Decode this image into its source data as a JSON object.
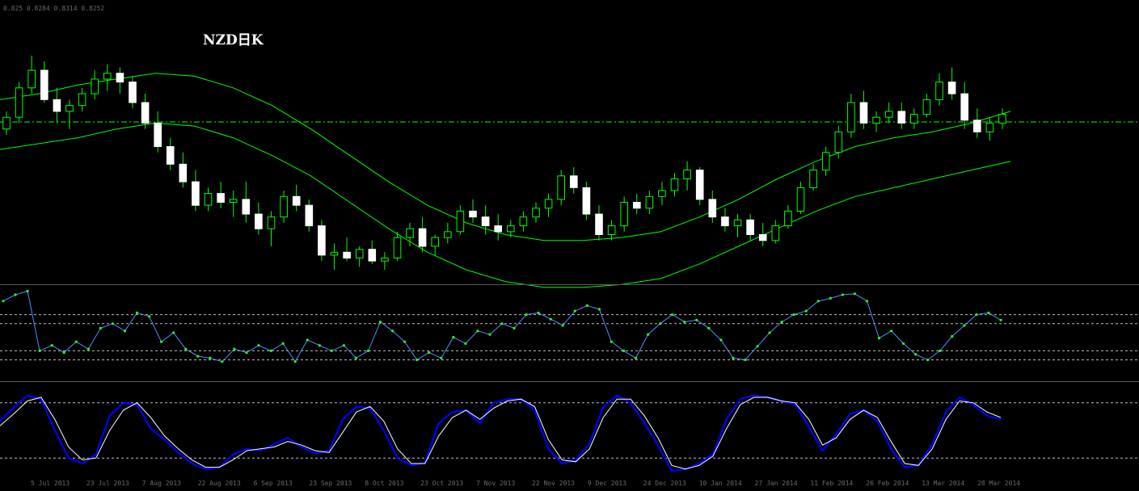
{
  "header": {
    "title": "NZD日K",
    "info": "0.825 0.8284 0.8314 0.8252"
  },
  "colors": {
    "background": "#000000",
    "bull_body": "#000000",
    "bull_outline": "#00ff00",
    "bear_body": "#ffffff",
    "wick": "#00ff00",
    "envelope": "#00ff00",
    "price_line": "#00ff00",
    "rsi_line": "#4f8fff",
    "rsi_marker": "#22ff22",
    "stoch_main": "#0000ff",
    "stoch_signal": "#ffffff",
    "level_line": "#c0c0c0",
    "separator": "#5a5a5a",
    "axis_text": "#6a6a6a"
  },
  "time_axis": {
    "labels": [
      "5 Jul 2013",
      "23 Jul 2013",
      "7 Aug 2013",
      "22 Aug 2013",
      "6 Sep 2013",
      "23 Sep 2013",
      "8 Oct 2013",
      "23 Oct 2013",
      "7 Nov 2013",
      "22 Nov 2013",
      "9 Dec 2013",
      "24 Dec 2013",
      "10 Jan 2014",
      "27 Jan 2014",
      "11 Feb 2014",
      "26 Feb 2014",
      "13 Mar 2014",
      "28 Mar 2014"
    ]
  },
  "chart_data": [
    {
      "type": "candlestick",
      "name": "price",
      "ylim": [
        0.775,
        0.865
      ],
      "current_price": 0.8284,
      "envelope_upper": [
        0.836,
        0.838,
        0.841,
        0.843,
        0.845,
        0.844,
        0.84,
        0.834,
        0.826,
        0.817,
        0.808,
        0.8,
        0.794,
        0.79,
        0.788,
        0.788,
        0.789,
        0.791,
        0.796,
        0.802,
        0.809,
        0.815,
        0.82,
        0.823,
        0.825,
        0.828,
        0.832
      ],
      "envelope_lower": [
        0.819,
        0.821,
        0.823,
        0.826,
        0.828,
        0.827,
        0.823,
        0.817,
        0.81,
        0.801,
        0.792,
        0.784,
        0.778,
        0.774,
        0.772,
        0.772,
        0.773,
        0.775,
        0.78,
        0.786,
        0.792,
        0.798,
        0.803,
        0.806,
        0.809,
        0.812,
        0.815
      ],
      "candles": [
        [
          0.826,
          0.832,
          0.824,
          0.83
        ],
        [
          0.83,
          0.842,
          0.828,
          0.84
        ],
        [
          0.84,
          0.851,
          0.838,
          0.846
        ],
        [
          0.846,
          0.849,
          0.835,
          0.836
        ],
        [
          0.836,
          0.84,
          0.828,
          0.832
        ],
        [
          0.832,
          0.836,
          0.826,
          0.834
        ],
        [
          0.834,
          0.84,
          0.832,
          0.838
        ],
        [
          0.838,
          0.846,
          0.836,
          0.843
        ],
        [
          0.843,
          0.848,
          0.839,
          0.845
        ],
        [
          0.845,
          0.847,
          0.838,
          0.842
        ],
        [
          0.842,
          0.844,
          0.833,
          0.835
        ],
        [
          0.835,
          0.838,
          0.826,
          0.828
        ],
        [
          0.828,
          0.832,
          0.818,
          0.82
        ],
        [
          0.82,
          0.823,
          0.812,
          0.814
        ],
        [
          0.814,
          0.818,
          0.806,
          0.808
        ],
        [
          0.808,
          0.812,
          0.798,
          0.8
        ],
        [
          0.8,
          0.806,
          0.798,
          0.804
        ],
        [
          0.804,
          0.808,
          0.799,
          0.801
        ],
        [
          0.801,
          0.805,
          0.796,
          0.802
        ],
        [
          0.802,
          0.808,
          0.794,
          0.797
        ],
        [
          0.797,
          0.801,
          0.79,
          0.792
        ],
        [
          0.792,
          0.798,
          0.786,
          0.796
        ],
        [
          0.796,
          0.805,
          0.794,
          0.803
        ],
        [
          0.803,
          0.807,
          0.798,
          0.8
        ],
        [
          0.8,
          0.802,
          0.791,
          0.793
        ],
        [
          0.793,
          0.795,
          0.781,
          0.783
        ],
        [
          0.783,
          0.787,
          0.778,
          0.784
        ],
        [
          0.784,
          0.789,
          0.781,
          0.782
        ],
        [
          0.782,
          0.786,
          0.779,
          0.785
        ],
        [
          0.785,
          0.788,
          0.78,
          0.781
        ],
        [
          0.781,
          0.784,
          0.778,
          0.782
        ],
        [
          0.782,
          0.791,
          0.781,
          0.789
        ],
        [
          0.789,
          0.794,
          0.786,
          0.792
        ],
        [
          0.792,
          0.796,
          0.784,
          0.786
        ],
        [
          0.786,
          0.79,
          0.783,
          0.789
        ],
        [
          0.789,
          0.794,
          0.787,
          0.791
        ],
        [
          0.791,
          0.8,
          0.79,
          0.798
        ],
        [
          0.798,
          0.802,
          0.794,
          0.796
        ],
        [
          0.796,
          0.8,
          0.79,
          0.793
        ],
        [
          0.793,
          0.797,
          0.788,
          0.791
        ],
        [
          0.791,
          0.795,
          0.789,
          0.793
        ],
        [
          0.793,
          0.798,
          0.791,
          0.796
        ],
        [
          0.796,
          0.801,
          0.794,
          0.799
        ],
        [
          0.799,
          0.804,
          0.796,
          0.802
        ],
        [
          0.802,
          0.812,
          0.8,
          0.81
        ],
        [
          0.81,
          0.813,
          0.804,
          0.806
        ],
        [
          0.806,
          0.808,
          0.795,
          0.797
        ],
        [
          0.797,
          0.8,
          0.788,
          0.79
        ],
        [
          0.79,
          0.795,
          0.788,
          0.793
        ],
        [
          0.793,
          0.803,
          0.791,
          0.801
        ],
        [
          0.801,
          0.804,
          0.797,
          0.799
        ],
        [
          0.799,
          0.805,
          0.797,
          0.803
        ],
        [
          0.803,
          0.808,
          0.8,
          0.805
        ],
        [
          0.805,
          0.811,
          0.803,
          0.809
        ],
        [
          0.809,
          0.815,
          0.805,
          0.812
        ],
        [
          0.812,
          0.813,
          0.8,
          0.802
        ],
        [
          0.802,
          0.805,
          0.794,
          0.796
        ],
        [
          0.796,
          0.799,
          0.791,
          0.793
        ],
        [
          0.793,
          0.797,
          0.789,
          0.795
        ],
        [
          0.795,
          0.797,
          0.788,
          0.79
        ],
        [
          0.79,
          0.794,
          0.786,
          0.788
        ],
        [
          0.788,
          0.795,
          0.787,
          0.793
        ],
        [
          0.793,
          0.8,
          0.792,
          0.798
        ],
        [
          0.798,
          0.808,
          0.797,
          0.806
        ],
        [
          0.806,
          0.814,
          0.805,
          0.812
        ],
        [
          0.812,
          0.82,
          0.81,
          0.818
        ],
        [
          0.818,
          0.827,
          0.816,
          0.825
        ],
        [
          0.825,
          0.838,
          0.823,
          0.835
        ],
        [
          0.835,
          0.839,
          0.826,
          0.828
        ],
        [
          0.828,
          0.832,
          0.825,
          0.83
        ],
        [
          0.83,
          0.835,
          0.828,
          0.832
        ],
        [
          0.832,
          0.835,
          0.826,
          0.828
        ],
        [
          0.828,
          0.833,
          0.826,
          0.831
        ],
        [
          0.831,
          0.838,
          0.83,
          0.836
        ],
        [
          0.836,
          0.845,
          0.834,
          0.842
        ],
        [
          0.842,
          0.847,
          0.836,
          0.838
        ],
        [
          0.838,
          0.842,
          0.826,
          0.829
        ],
        [
          0.829,
          0.833,
          0.823,
          0.825
        ],
        [
          0.825,
          0.83,
          0.822,
          0.828
        ],
        [
          0.828,
          0.833,
          0.826,
          0.831
        ]
      ]
    },
    {
      "type": "line",
      "name": "oscillator-1",
      "ylim": [
        0,
        100
      ],
      "levels": [
        70,
        60,
        30,
        20
      ],
      "values": [
        85,
        92,
        96,
        30,
        36,
        28,
        40,
        32,
        55,
        60,
        52,
        72,
        68,
        40,
        50,
        32,
        24,
        22,
        18,
        32,
        28,
        36,
        30,
        38,
        18,
        42,
        36,
        30,
        36,
        22,
        30,
        62,
        52,
        40,
        20,
        28,
        22,
        45,
        38,
        52,
        48,
        60,
        55,
        70,
        72,
        65,
        58,
        74,
        80,
        76,
        40,
        30,
        22,
        48,
        60,
        70,
        62,
        64,
        55,
        42,
        22,
        20,
        35,
        50,
        62,
        70,
        74,
        85,
        88,
        92,
        93,
        85,
        44,
        52,
        38,
        26,
        20,
        30,
        46,
        58,
        70,
        72,
        64
      ]
    },
    {
      "type": "line",
      "name": "oscillator-2",
      "ylim": [
        0,
        100
      ],
      "levels": [
        80,
        20
      ],
      "main": [
        60,
        75,
        88,
        84,
        50,
        20,
        14,
        24,
        66,
        80,
        78,
        52,
        40,
        26,
        14,
        8,
        10,
        24,
        30,
        28,
        35,
        42,
        32,
        25,
        28,
        62,
        76,
        74,
        50,
        20,
        12,
        15,
        58,
        70,
        72,
        58,
        80,
        84,
        84,
        72,
        30,
        14,
        18,
        36,
        75,
        88,
        80,
        58,
        34,
        6,
        8,
        14,
        24,
        62,
        84,
        88,
        86,
        82,
        78,
        54,
        28,
        46,
        68,
        72,
        60,
        30,
        10,
        12,
        35,
        70,
        86,
        78,
        66,
        62
      ],
      "signal": [
        55,
        68,
        82,
        86,
        62,
        32,
        18,
        20,
        50,
        72,
        80,
        64,
        44,
        30,
        18,
        10,
        10,
        18,
        28,
        30,
        32,
        38,
        34,
        28,
        26,
        48,
        70,
        76,
        60,
        30,
        14,
        14,
        44,
        64,
        72,
        62,
        74,
        82,
        84,
        76,
        40,
        18,
        16,
        30,
        64,
        84,
        84,
        66,
        42,
        12,
        8,
        12,
        22,
        52,
        78,
        86,
        86,
        82,
        80,
        62,
        34,
        42,
        62,
        72,
        64,
        38,
        14,
        12,
        30,
        62,
        82,
        80,
        70,
        64
      ]
    }
  ]
}
